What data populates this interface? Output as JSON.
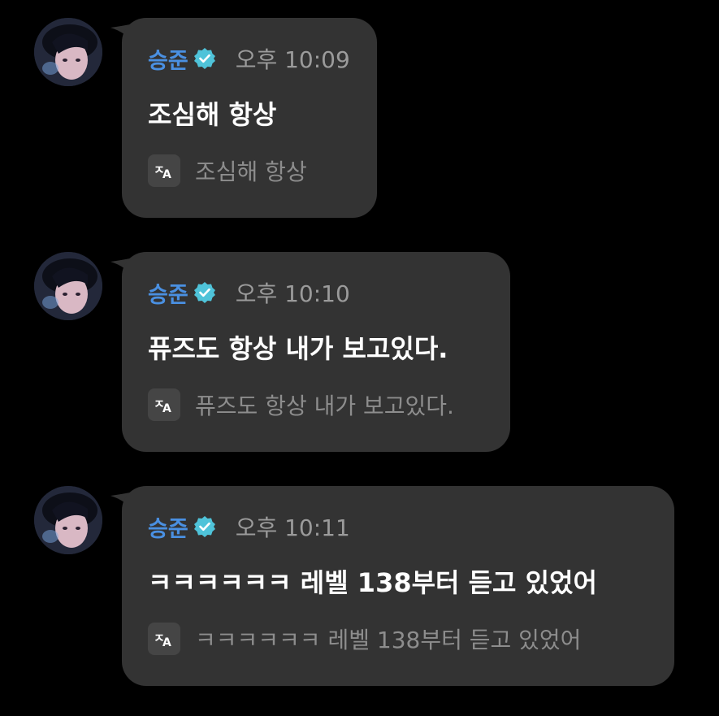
{
  "colors": {
    "background": "#000000",
    "bubble": "#333333",
    "name": "#4a90e2",
    "verified_badge": "#4fc3d9",
    "time": "#9b9b9b",
    "message_text": "#ffffff",
    "translation_text": "#8d8d8d"
  },
  "messages": [
    {
      "sender": "승준",
      "verified_icon": "verified-badge-icon",
      "time": "오후 10:09",
      "text": "조심해 항상",
      "translation_icon": "translate-icon",
      "translation": "조심해 항상"
    },
    {
      "sender": "승준",
      "verified_icon": "verified-badge-icon",
      "time": "오후 10:10",
      "text": "퓨즈도 항상 내가 보고있다.",
      "translation_icon": "translate-icon",
      "translation": "퓨즈도 항상 내가 보고있다."
    },
    {
      "sender": "승준",
      "verified_icon": "verified-badge-icon",
      "time": "오후 10:11",
      "text": "ㅋㅋㅋㅋㅋㅋ 레벨 138부터 듣고 있었어",
      "translation_icon": "translate-icon",
      "translation": "ㅋㅋㅋㅋㅋㅋ 레벨 138부터 듣고 있었어"
    }
  ]
}
